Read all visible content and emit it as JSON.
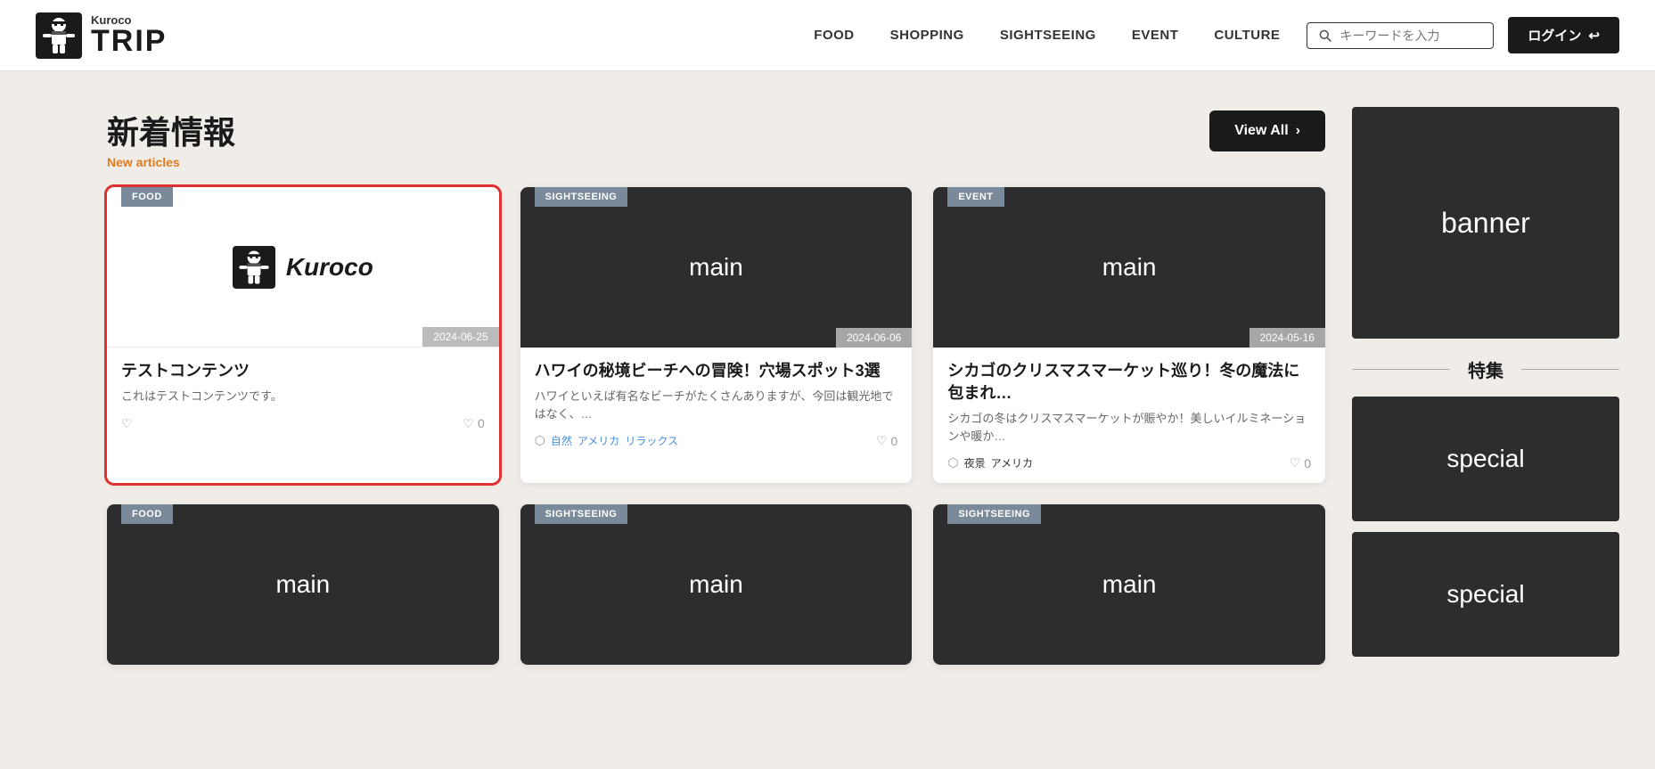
{
  "header": {
    "logo_kuroco": "Kuroco",
    "logo_trip": "TRIP",
    "nav": [
      {
        "label": "FOOD",
        "id": "nav-food"
      },
      {
        "label": "SHOPPING",
        "id": "nav-shopping"
      },
      {
        "label": "SIGHTSEEING",
        "id": "nav-sightseeing"
      },
      {
        "label": "EVENT",
        "id": "nav-event"
      },
      {
        "label": "CULTURE",
        "id": "nav-culture"
      }
    ],
    "search_placeholder": "キーワードを入力",
    "login_label": "ログイン"
  },
  "section": {
    "title": "新着情報",
    "subtitle": "New articles",
    "view_all": "View All"
  },
  "cards_row1": [
    {
      "id": "card-1",
      "category": "FOOD",
      "highlighted": true,
      "image_type": "kuroco",
      "date": "2024-06-25",
      "title": "テストコンテンツ",
      "description": "これはテストコンテンツです。",
      "tags": [],
      "likes": "0"
    },
    {
      "id": "card-2",
      "category": "SIGHTSEEING",
      "highlighted": false,
      "image_type": "dark",
      "date": "2024-06-06",
      "title": "ハワイの秘境ビーチへの冒険！穴場スポット3選",
      "description": "ハワイといえば有名なビーチがたくさんありますが、今回は観光地ではなく、…",
      "tags": [
        "自然",
        "アメリカ",
        "リラックス"
      ],
      "likes": "0"
    },
    {
      "id": "card-3",
      "category": "EVENT",
      "highlighted": false,
      "image_type": "dark",
      "date": "2024-05-16",
      "title": "シカゴのクリスマスマーケット巡り！冬の魔法に包まれ…",
      "description": "シカゴの冬はクリスマスマーケットが賑やか！美しいイルミネーションや暖か…",
      "tags": [
        "夜景",
        "アメリカ"
      ],
      "tag_colors": [
        "dark",
        "dark"
      ],
      "likes": "0"
    }
  ],
  "cards_row2": [
    {
      "id": "card-4",
      "category": "FOOD",
      "image_type": "dark",
      "date": "",
      "title": "",
      "description": "",
      "tags": [],
      "likes": ""
    },
    {
      "id": "card-5",
      "category": "SIGHTSEEING",
      "image_type": "dark",
      "date": "",
      "title": "",
      "description": "",
      "tags": [],
      "likes": ""
    },
    {
      "id": "card-6",
      "category": "SIGHTSEEING",
      "image_type": "dark",
      "date": "",
      "title": "",
      "description": "",
      "tags": [],
      "likes": ""
    }
  ],
  "sidebar": {
    "banner_label": "banner",
    "tokushu_label": "特集",
    "special1_label": "special",
    "special2_label": "special"
  }
}
